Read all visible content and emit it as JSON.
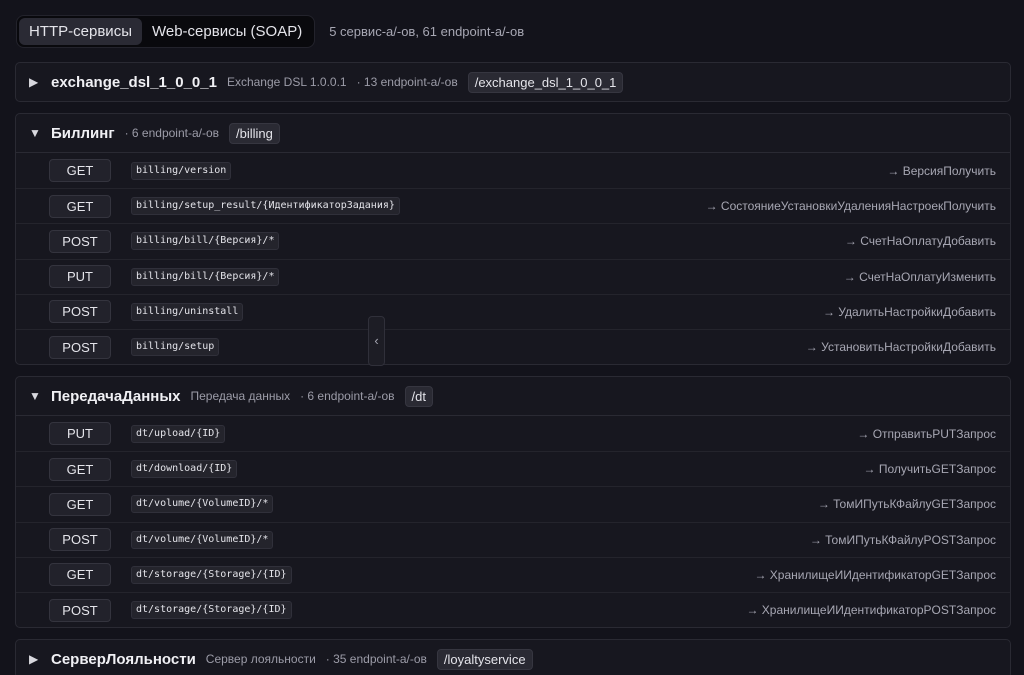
{
  "tabs": [
    {
      "label": "HTTP-сервисы",
      "active": true
    },
    {
      "label": "Web-сервисы (SOAP)",
      "active": false
    }
  ],
  "summary": "5 сервис-а/-ов, 61 endpoint-а/-ов",
  "icons": {
    "collapsed": "caret-right-icon",
    "expanded": "caret-down-icon",
    "collapse_handle": "chevron-left-icon"
  },
  "glyphs": {
    "collapsed": "▶",
    "expanded": "▼",
    "chevron_left": "‹"
  },
  "services": [
    {
      "name": "exchange_dsl_1_0_0_1",
      "description": "Exchange DSL 1.0.0.1",
      "count": "· 13 endpoint-а/-ов",
      "path": "/exchange_dsl_1_0_0_1",
      "expanded": false,
      "endpoints": []
    },
    {
      "name": "Биллинг",
      "description": "",
      "count": "· 6 endpoint-а/-ов",
      "path": "/billing",
      "expanded": true,
      "endpoints": [
        {
          "method": "GET",
          "path": "billing/version",
          "target": "→ ВерсияПолучить"
        },
        {
          "method": "GET",
          "path": "billing/setup_result/{ИдентификаторЗадания}",
          "target": "→ СостояниеУстановкиУдаленияНастроекПолучить"
        },
        {
          "method": "POST",
          "path": "billing/bill/{Версия}/*",
          "target": "→ СчетНаОплатуДобавить"
        },
        {
          "method": "PUT",
          "path": "billing/bill/{Версия}/*",
          "target": "→ СчетНаОплатуИзменить"
        },
        {
          "method": "POST",
          "path": "billing/uninstall",
          "target": "→ УдалитьНастройкиДобавить"
        },
        {
          "method": "POST",
          "path": "billing/setup",
          "target": "→ УстановитьНастройкиДобавить"
        }
      ]
    },
    {
      "name": "ПередачаДанных",
      "description": "Передача данных",
      "count": "· 6 endpoint-а/-ов",
      "path": "/dt",
      "expanded": true,
      "endpoints": [
        {
          "method": "PUT",
          "path": "dt/upload/{ID}",
          "target": "→ ОтправитьPUTЗапрос"
        },
        {
          "method": "GET",
          "path": "dt/download/{ID}",
          "target": "→ ПолучитьGETЗапрос"
        },
        {
          "method": "GET",
          "path": "dt/volume/{VolumeID}/*",
          "target": "→ ТомИПутьКФайлуGETЗапрос"
        },
        {
          "method": "POST",
          "path": "dt/volume/{VolumeID}/*",
          "target": "→ ТомИПутьКФайлуPOSTЗапрос"
        },
        {
          "method": "GET",
          "path": "dt/storage/{Storage}/{ID}",
          "target": "→ ХранилищеИИдентификаторGETЗапрос"
        },
        {
          "method": "POST",
          "path": "dt/storage/{Storage}/{ID}",
          "target": "→ ХранилищеИИдентификаторPOSTЗапрос"
        }
      ]
    },
    {
      "name": "СерверЛояльности",
      "description": "Сервер лояльности",
      "count": "· 35 endpoint-а/-ов",
      "path": "/loyaltyservice",
      "expanded": false,
      "endpoints": []
    }
  ]
}
